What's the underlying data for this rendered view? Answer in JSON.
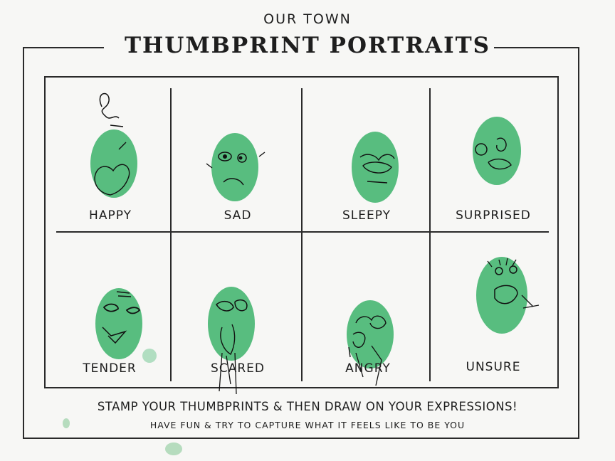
{
  "header": {
    "supertitle": "OUR TOWN",
    "title": "THUMBPRINT PORTRAITS"
  },
  "cells": [
    {
      "label": "HAPPY"
    },
    {
      "label": "SAD"
    },
    {
      "label": "SLEEPY"
    },
    {
      "label": "SURPRISED"
    },
    {
      "label": "TENDER"
    },
    {
      "label": "SCARED"
    },
    {
      "label": "ANGRY"
    },
    {
      "label": "UNSURE"
    }
  ],
  "footer": {
    "instruction": "STAMP YOUR THUMBPRINTS & THEN DRAW ON YOUR EXPRESSIONS!",
    "subline": "HAVE FUN & TRY TO CAPTURE  WHAT IT FEELS LIKE TO BE YOU"
  },
  "colors": {
    "ink": "#1e1e1e",
    "thumbprint": "#2fae62",
    "paper": "#f7f7f5"
  }
}
